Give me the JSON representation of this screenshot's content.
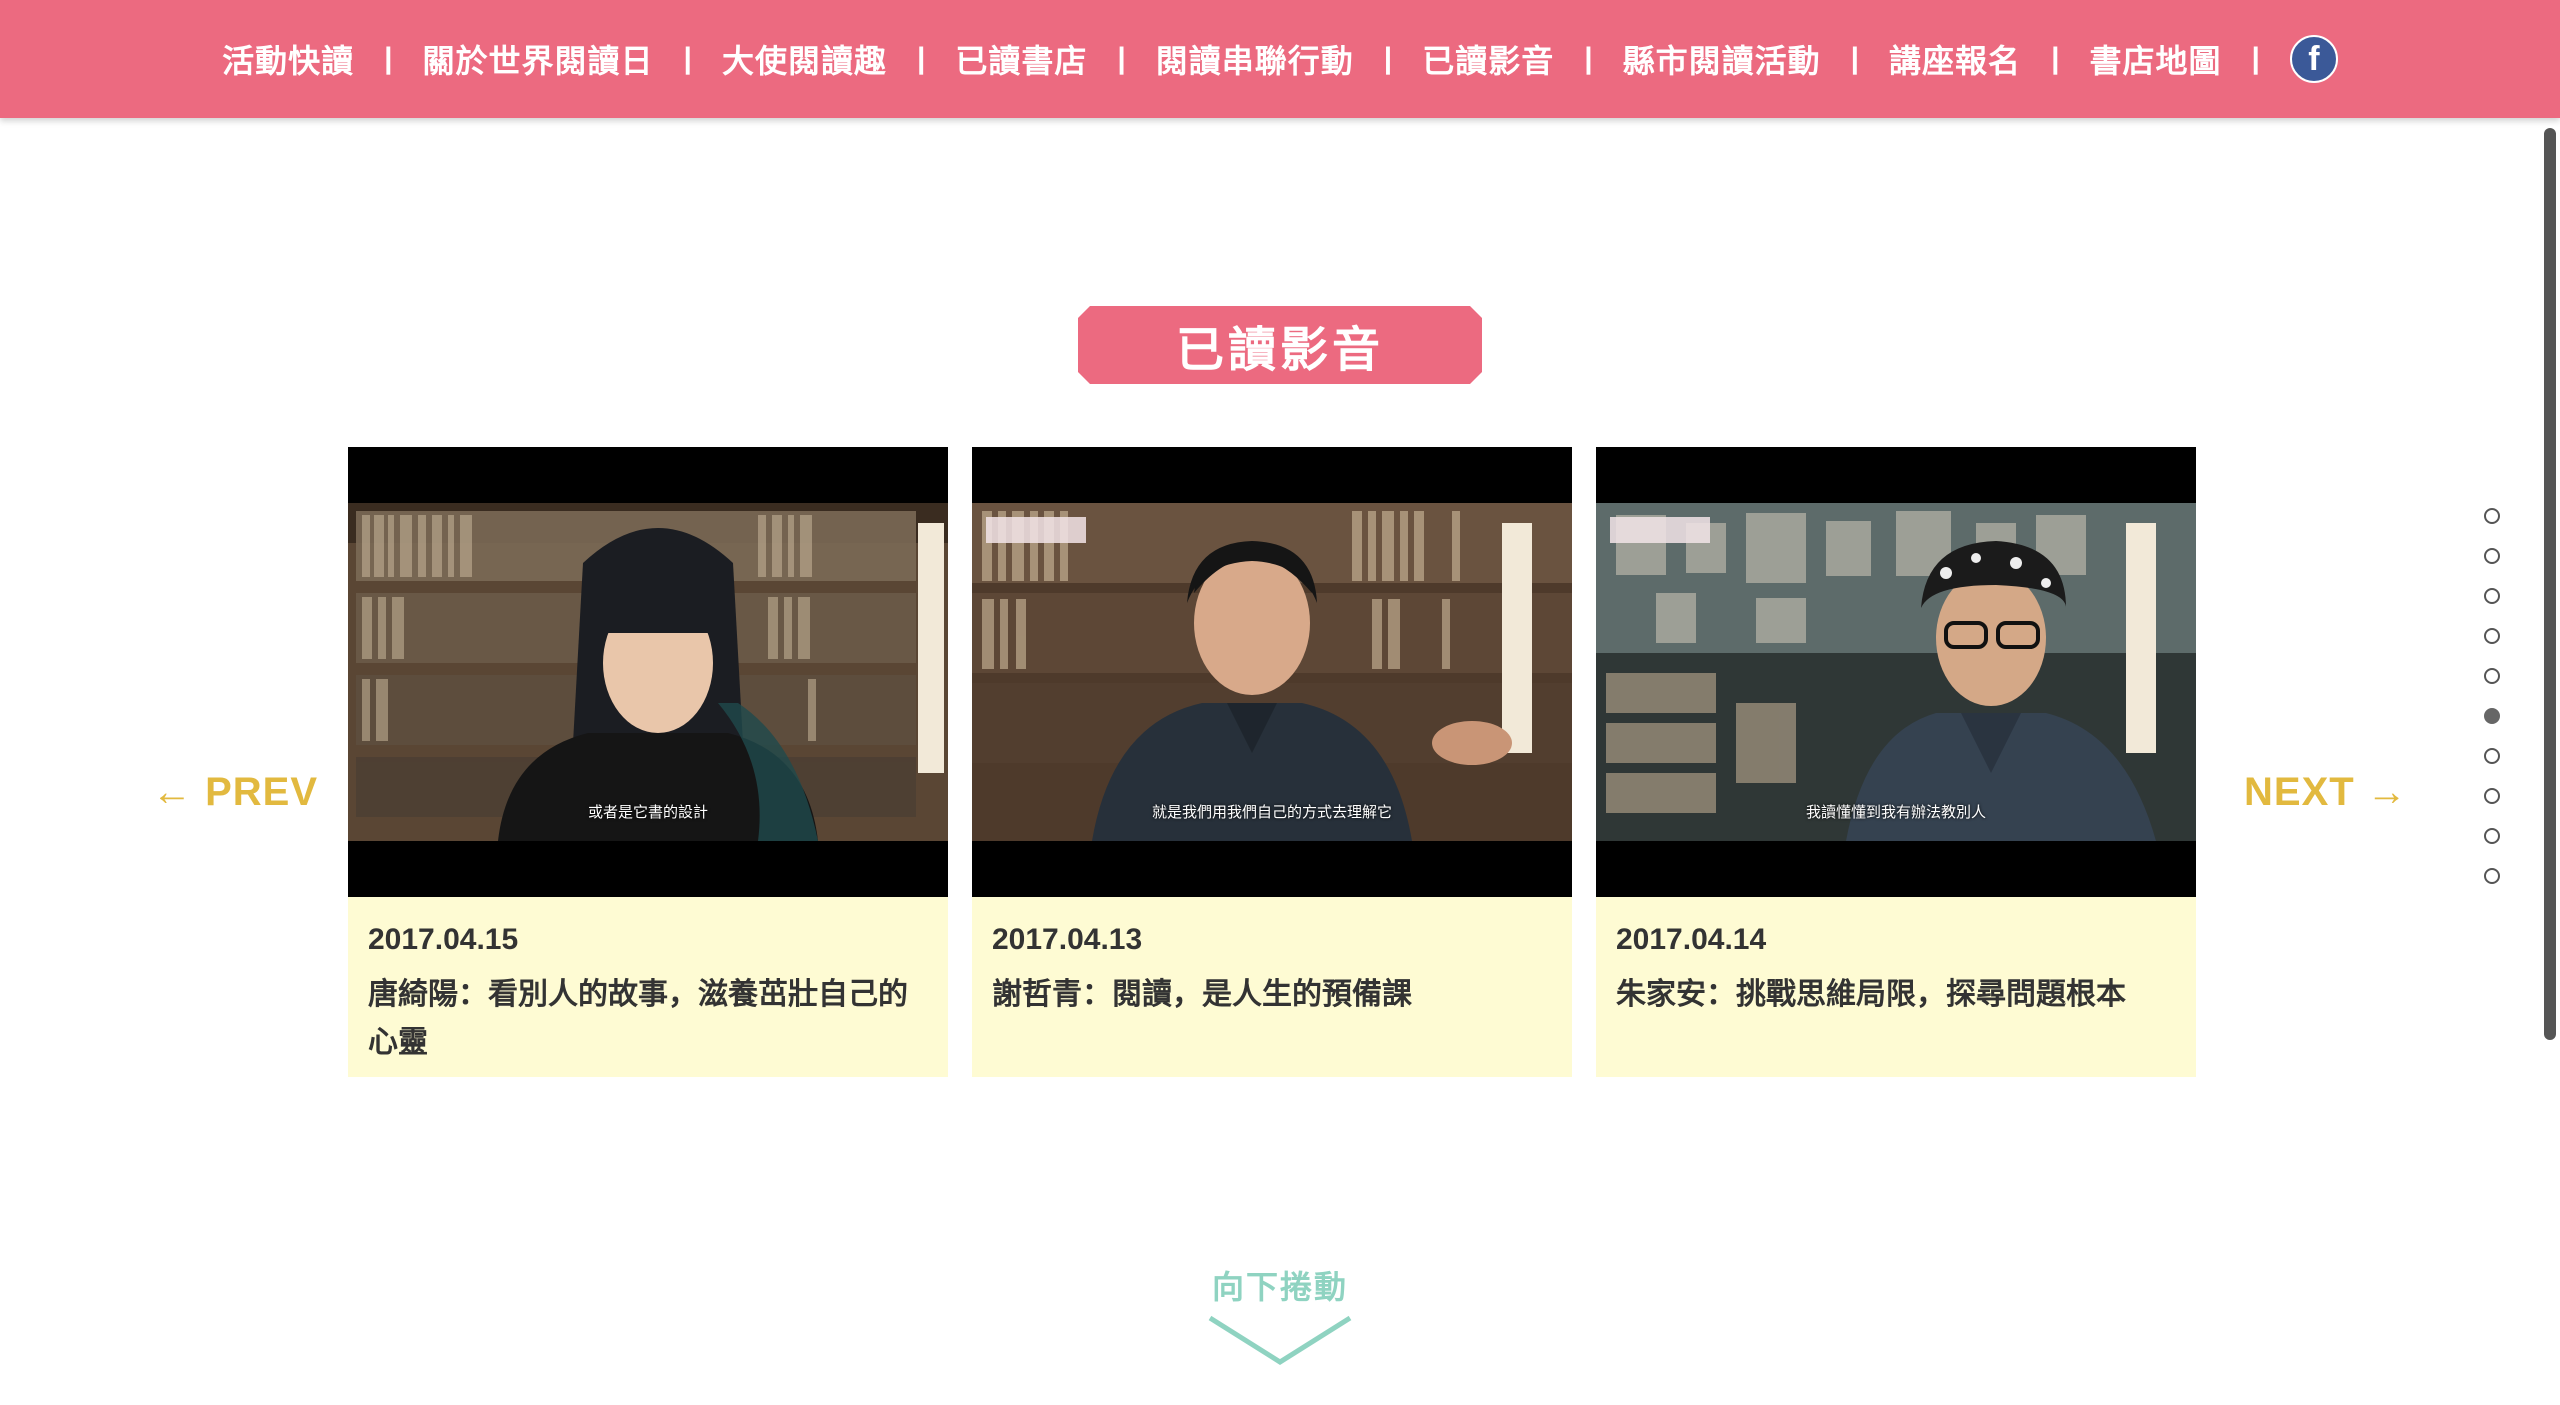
{
  "nav": {
    "items": [
      {
        "label": "活動快讀"
      },
      {
        "label": "關於世界閱讀日"
      },
      {
        "label": "大使閱讀趣"
      },
      {
        "label": "已讀書店"
      },
      {
        "label": "閱讀串聯行動"
      },
      {
        "label": "已讀影音"
      },
      {
        "label": "縣市閱讀活動"
      },
      {
        "label": "講座報名"
      },
      {
        "label": "書店地圖"
      }
    ],
    "separator": "|",
    "facebook_glyph": "f",
    "facebook_icon": "facebook-icon"
  },
  "section": {
    "title": "已讀影音"
  },
  "carousel": {
    "prev_label": "← PREV",
    "next_label": "NEXT →",
    "videos": [
      {
        "date": "2017.04.15",
        "title": "唐綺陽：看別人的故事，滋養茁壯自己的心靈",
        "subtitle": "或者是它書的設計"
      },
      {
        "date": "2017.04.13",
        "title": "謝哲青：閱讀，是人生的預備課",
        "subtitle": "就是我們用我們自己的方式去理解它"
      },
      {
        "date": "2017.04.14",
        "title": "朱家安：挑戰思維局限，探尋問題根本",
        "subtitle": "我讀懂懂到我有辦法教別人"
      }
    ]
  },
  "pager": {
    "count": 10,
    "active_index": 5
  },
  "scroll_hint": {
    "label": "向下捲動"
  },
  "colors": {
    "brand_pink": "#ec6a80",
    "arrow_gold": "#e2b93f",
    "card_bg": "#fefbd3",
    "scroll_teal": "#8fd3c1"
  }
}
